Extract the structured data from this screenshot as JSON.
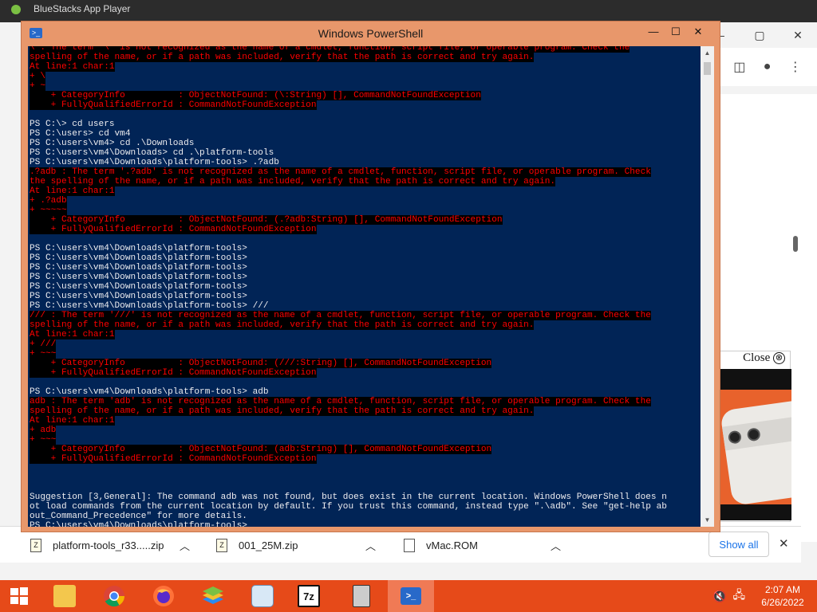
{
  "background_app": {
    "title": "BlueStacks App Player"
  },
  "browser": {
    "window_controls": [
      "–",
      "▢",
      "✕"
    ],
    "ad": {
      "close_label": "Close",
      "close_icon": "⊗"
    },
    "downloads": [
      {
        "name": "platform-tools_r33.....zip",
        "icon": "zip-icon"
      },
      {
        "name": "001_25M.zip",
        "icon": "zip-icon"
      },
      {
        "name": "vMac.ROM",
        "icon": "file-icon"
      }
    ],
    "show_all_label": "Show all",
    "close_label": "✕"
  },
  "powershell": {
    "title": "Windows PowerShell",
    "controls": {
      "minimize": "—",
      "maximize": "☐",
      "close": "✕"
    },
    "lines": [
      {
        "t": "err",
        "text": "\\ : The term '\\' is not recognized as the name of a cmdlet, function, script file, or operable program. Check the"
      },
      {
        "t": "err",
        "text": "spelling of the name, or if a path was included, verify that the path is correct and try again."
      },
      {
        "t": "err",
        "text": "At line:1 char:1"
      },
      {
        "t": "err",
        "text": "+ \\"
      },
      {
        "t": "err",
        "text": "+ ~"
      },
      {
        "t": "err",
        "text": "    + CategoryInfo          : ObjectNotFound: (\\:String) [], CommandNotFoundException"
      },
      {
        "t": "err",
        "text": "    + FullyQualifiedErrorId : CommandNotFoundException"
      },
      {
        "t": "out",
        "text": ""
      },
      {
        "t": "out",
        "text": "PS C:\\> cd users"
      },
      {
        "t": "out",
        "text": "PS C:\\users> cd vm4"
      },
      {
        "t": "out",
        "text": "PS C:\\users\\vm4> cd .\\Downloads"
      },
      {
        "t": "out",
        "text": "PS C:\\users\\vm4\\Downloads> cd .\\platform-tools"
      },
      {
        "t": "out",
        "text": "PS C:\\users\\vm4\\Downloads\\platform-tools> .?adb"
      },
      {
        "t": "err",
        "text": ".?adb : The term '.?adb' is not recognized as the name of a cmdlet, function, script file, or operable program. Check"
      },
      {
        "t": "err",
        "text": "the spelling of the name, or if a path was included, verify that the path is correct and try again."
      },
      {
        "t": "err",
        "text": "At line:1 char:1"
      },
      {
        "t": "err",
        "text": "+ .?adb"
      },
      {
        "t": "err",
        "text": "+ ~~~~~"
      },
      {
        "t": "err",
        "text": "    + CategoryInfo          : ObjectNotFound: (.?adb:String) [], CommandNotFoundException"
      },
      {
        "t": "err",
        "text": "    + FullyQualifiedErrorId : CommandNotFoundException"
      },
      {
        "t": "out",
        "text": ""
      },
      {
        "t": "out",
        "text": "PS C:\\users\\vm4\\Downloads\\platform-tools>"
      },
      {
        "t": "out",
        "text": "PS C:\\users\\vm4\\Downloads\\platform-tools>"
      },
      {
        "t": "out",
        "text": "PS C:\\users\\vm4\\Downloads\\platform-tools>"
      },
      {
        "t": "out",
        "text": "PS C:\\users\\vm4\\Downloads\\platform-tools>"
      },
      {
        "t": "out",
        "text": "PS C:\\users\\vm4\\Downloads\\platform-tools>"
      },
      {
        "t": "out",
        "text": "PS C:\\users\\vm4\\Downloads\\platform-tools>"
      },
      {
        "t": "out",
        "text": "PS C:\\users\\vm4\\Downloads\\platform-tools> ///"
      },
      {
        "t": "err",
        "text": "/// : The term '///' is not recognized as the name of a cmdlet, function, script file, or operable program. Check the"
      },
      {
        "t": "err",
        "text": "spelling of the name, or if a path was included, verify that the path is correct and try again."
      },
      {
        "t": "err",
        "text": "At line:1 char:1"
      },
      {
        "t": "err",
        "text": "+ ///"
      },
      {
        "t": "err",
        "text": "+ ~~~"
      },
      {
        "t": "err",
        "text": "    + CategoryInfo          : ObjectNotFound: (///:String) [], CommandNotFoundException"
      },
      {
        "t": "err",
        "text": "    + FullyQualifiedErrorId : CommandNotFoundException"
      },
      {
        "t": "out",
        "text": ""
      },
      {
        "t": "out",
        "text": "PS C:\\users\\vm4\\Downloads\\platform-tools> adb"
      },
      {
        "t": "err",
        "text": "adb : The term 'adb' is not recognized as the name of a cmdlet, function, script file, or operable program. Check the"
      },
      {
        "t": "err",
        "text": "spelling of the name, or if a path was included, verify that the path is correct and try again."
      },
      {
        "t": "err",
        "text": "At line:1 char:1"
      },
      {
        "t": "err",
        "text": "+ adb"
      },
      {
        "t": "err",
        "text": "+ ~~~"
      },
      {
        "t": "err",
        "text": "    + CategoryInfo          : ObjectNotFound: (adb:String) [], CommandNotFoundException"
      },
      {
        "t": "err",
        "text": "    + FullyQualifiedErrorId : CommandNotFoundException"
      },
      {
        "t": "out",
        "text": ""
      },
      {
        "t": "out",
        "text": ""
      },
      {
        "t": "out",
        "text": ""
      },
      {
        "t": "out",
        "text": "Suggestion [3,General]: The command adb was not found, but does exist in the current location. Windows PowerShell does n"
      },
      {
        "t": "out",
        "text": "ot load commands from the current location by default. If you trust this command, instead type \".\\adb\". See \"get-help ab"
      },
      {
        "t": "out",
        "text": "out_Command_Precedence\" for more details."
      },
      {
        "t": "prompt",
        "text": "PS C:\\users\\vm4\\Downloads\\platform-tools> "
      }
    ]
  },
  "taskbar": {
    "apps": [
      {
        "name": "start-button",
        "icon": "windows-logo-icon"
      },
      {
        "name": "file-explorer",
        "icon": "folder-icon"
      },
      {
        "name": "chrome",
        "icon": "chrome-icon"
      },
      {
        "name": "firefox",
        "icon": "firefox-icon"
      },
      {
        "name": "bluestacks",
        "icon": "bluestacks-icon"
      },
      {
        "name": "control-panel",
        "icon": "control-panel-icon"
      },
      {
        "name": "7zip",
        "icon": "7z-icon",
        "label": "7z"
      },
      {
        "name": "vmac",
        "icon": "vmac-icon"
      },
      {
        "name": "powershell",
        "icon": "powershell-icon"
      }
    ],
    "tray": {
      "volume": "🔇",
      "network": "🖧"
    },
    "time": "2:07 AM",
    "date": "6/26/2022"
  },
  "colors": {
    "console_bg": "#012456",
    "error_fg": "#ff0000",
    "error_bg": "#000000",
    "ps_frame": "#e8976b",
    "taskbar": "#e64a19"
  }
}
